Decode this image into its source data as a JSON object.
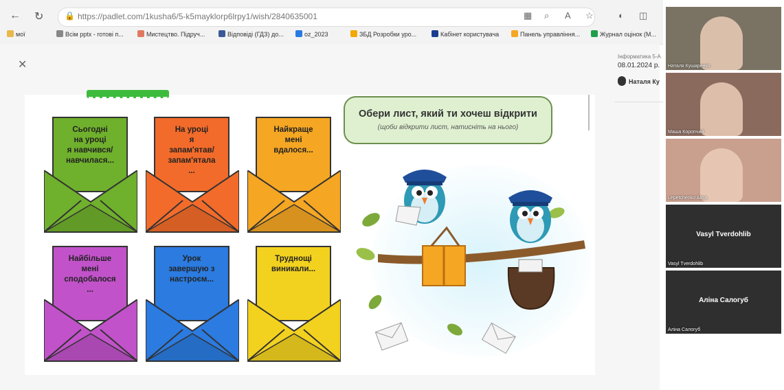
{
  "browser": {
    "url": "https://padlet.com/1kusha6/5-k5mayklorp6lrpy1/wish/2840635001",
    "bookmarks": [
      {
        "label": "мої",
        "color": "#e8b84a"
      },
      {
        "label": "Всім pptx - готові п...",
        "color": "#888888"
      },
      {
        "label": "Мистецтво. Підруч...",
        "color": "#e07a5f"
      },
      {
        "label": "Відповіді (ГДЗ) до...",
        "color": "#3b5998"
      },
      {
        "label": "oz_2023",
        "color": "#2a7ae2"
      },
      {
        "label": "ЗБД Розробки уро...",
        "color": "#f2a900"
      },
      {
        "label": "Кабінет користувача",
        "color": "#1a3d8f"
      },
      {
        "label": "Панель управління...",
        "color": "#f5a623"
      },
      {
        "label": "Журнал оцінок (М...",
        "color": "#1e9e4a"
      }
    ]
  },
  "slide": {
    "bubble_title": "Обери лист, який ти хочеш відкрити",
    "bubble_subtitle": "(щоби відкрити лист, натисніть на нього)",
    "envelopes": [
      {
        "text": "Сьогодні\nна уроці\nя навчився/\nнавчилася...",
        "color": "#6fb02c"
      },
      {
        "text": "На уроці\nя\nзапам'ятав/\nзапам'ятала\n...",
        "color": "#f26b2a"
      },
      {
        "text": "Найкраще\nмені\nвдалося...",
        "color": "#f5a623"
      },
      {
        "text": "Найбільше\nмені\nсподобалося\n...",
        "color": "#c152c9"
      },
      {
        "text": "Урок\nзавершую з\nнастроєм...",
        "color": "#2b7be0"
      },
      {
        "text": "Труднощі\nвиникали...",
        "color": "#f3d21f"
      }
    ]
  },
  "side_panel": {
    "subtitle": "Інформатика 5-А",
    "date": "08.01.2024 р.",
    "user": "Наталя Ку"
  },
  "participants": [
    {
      "name": "Наталя Кушаренко",
      "video": true,
      "bg": "#7a7262"
    },
    {
      "name": "Маша Коропчий",
      "video": true,
      "bg": "#8b6a5e"
    },
    {
      "name": "Lepetchenko Alina",
      "video": true,
      "bg": "#c99f8e"
    },
    {
      "name": "Vasyl Tverdohlib",
      "video": false,
      "bg": "#2f2f2f"
    },
    {
      "name": "Аліна Салогуб",
      "video": false,
      "bg": "#2f2f2f"
    }
  ]
}
